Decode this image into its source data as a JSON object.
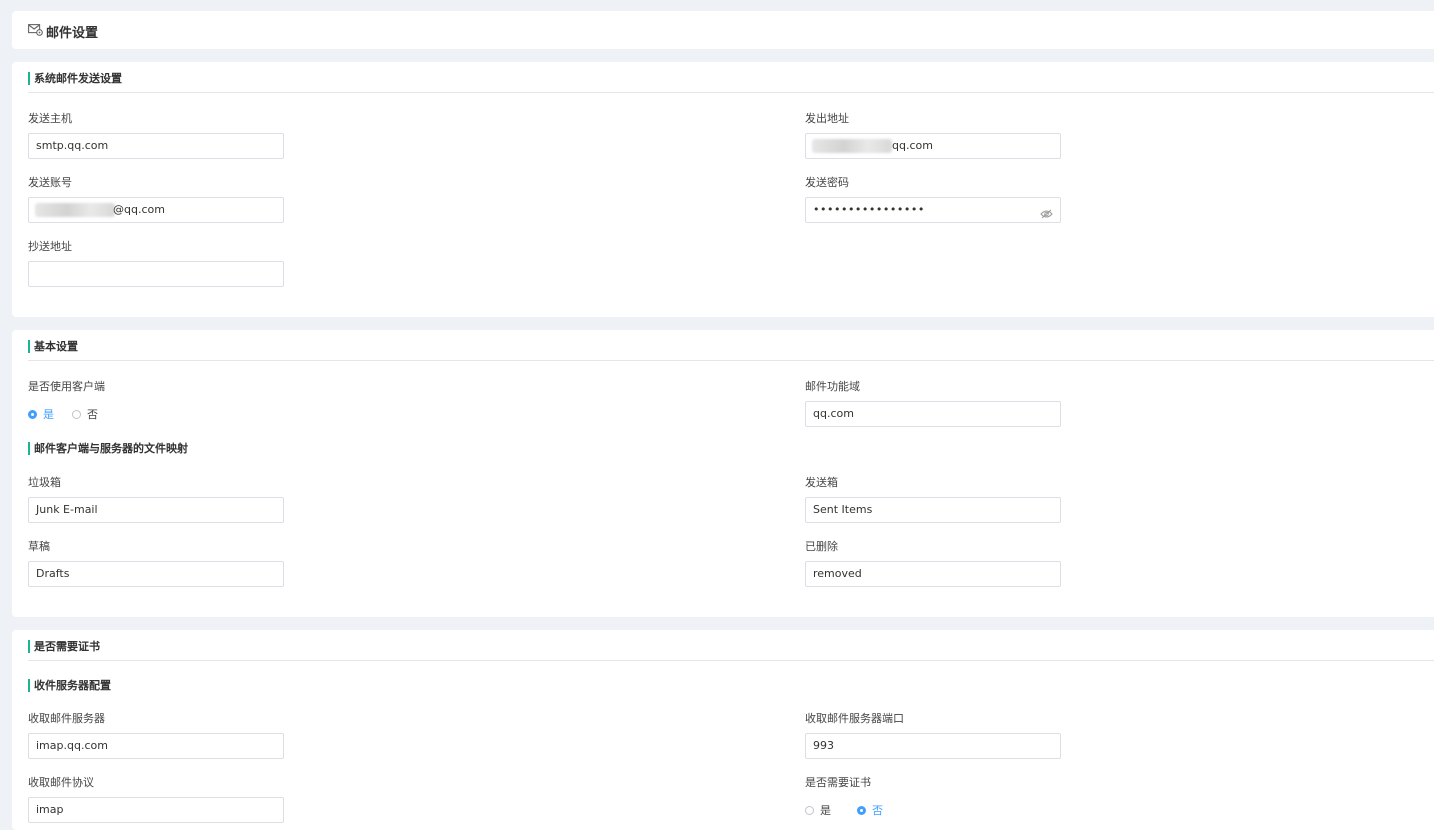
{
  "header": {
    "title": "邮件设置",
    "icon": "mail-settings-icon"
  },
  "system_send": {
    "title": "系统邮件发送设置",
    "send_host": {
      "label": "发送主机",
      "value": "smtp.qq.com"
    },
    "send_from": {
      "label": "发出地址",
      "value": "qq.com"
    },
    "send_account": {
      "label": "发送账号",
      "value": "@qq.com"
    },
    "send_password": {
      "label": "发送密码",
      "value": "••••••••••••••••"
    },
    "cc_address": {
      "label": "抄送地址",
      "value": ""
    }
  },
  "basic": {
    "title": "基本设置",
    "use_client": {
      "label": "是否使用客户端",
      "options": [
        "是",
        "否"
      ],
      "selected": "是"
    },
    "mail_domain": {
      "label": "邮件功能域",
      "value": "qq.com"
    },
    "mapping_title": "邮件客户端与服务器的文件映射",
    "junk": {
      "label": "垃圾箱",
      "value": "Junk E-mail"
    },
    "sent": {
      "label": "发送箱",
      "value": "Sent Items"
    },
    "drafts": {
      "label": "草稿",
      "value": "Drafts"
    },
    "deleted": {
      "label": "已删除",
      "value": "removed"
    }
  },
  "cert": {
    "title": "是否需要证书",
    "receive_title": "收件服务器配置",
    "receive_server": {
      "label": "收取邮件服务器",
      "value": "imap.qq.com"
    },
    "receive_port": {
      "label": "收取邮件服务器端口",
      "value": "993"
    },
    "receive_protocol": {
      "label": "收取邮件协议",
      "value": "imap"
    },
    "need_cert": {
      "label": "是否需要证书",
      "options": [
        "是",
        "否"
      ],
      "selected": "否"
    }
  },
  "colors": {
    "accent": "#1ab394",
    "radio": "#409eff",
    "background": "#eef1f6"
  }
}
